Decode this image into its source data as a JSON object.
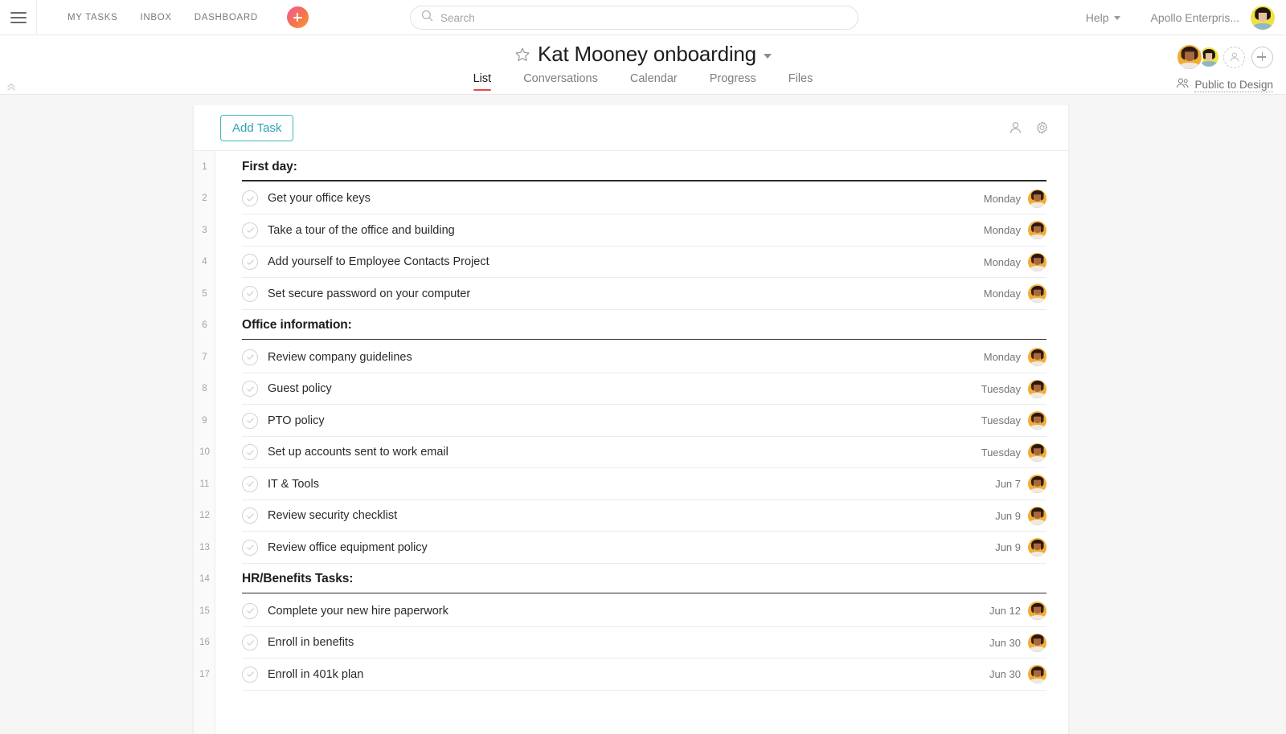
{
  "topbar": {
    "menu_icon": "hamburger-icon",
    "nav": [
      {
        "label": "MY TASKS"
      },
      {
        "label": "INBOX"
      },
      {
        "label": "DASHBOARD"
      }
    ],
    "quick_add_icon": "plus-icon",
    "search": {
      "placeholder": "Search",
      "value": "",
      "icon": "search-icon"
    },
    "help_label": "Help",
    "org_name": "Apollo Enterpris...",
    "user_avatar": "user-avatar"
  },
  "project": {
    "title": "Kat Mooney onboarding",
    "star_icon": "star-icon",
    "title_caret_icon": "chevron-down-icon",
    "tabs": [
      {
        "label": "List",
        "active": true
      },
      {
        "label": "Conversations",
        "active": false
      },
      {
        "label": "Calendar",
        "active": false
      },
      {
        "label": "Progress",
        "active": false
      },
      {
        "label": "Files",
        "active": false
      }
    ],
    "privacy_label": "Public to Design",
    "privacy_icon": "people-icon",
    "add_member_icon": "plus-circle-icon",
    "invite_placeholder_icon": "dashed-person-icon",
    "collapse_icon": "double-chevron-up-icon"
  },
  "toolbar": {
    "add_task_label": "Add Task",
    "assignee_icon": "person-icon",
    "settings_icon": "gear-icon"
  },
  "list": {
    "rows": [
      {
        "num": "1",
        "type": "section",
        "name": "First day:"
      },
      {
        "num": "2",
        "type": "task",
        "name": "Get your office keys",
        "due": "Monday",
        "assignee": "user-avatar"
      },
      {
        "num": "3",
        "type": "task",
        "name": "Take a tour of the office and building",
        "due": "Monday",
        "assignee": "user-avatar"
      },
      {
        "num": "4",
        "type": "task",
        "name": "Add yourself to Employee Contacts Project",
        "due": "Monday",
        "assignee": "user-avatar"
      },
      {
        "num": "5",
        "type": "task",
        "name": "Set secure password on your computer",
        "due": "Monday",
        "assignee": "user-avatar"
      },
      {
        "num": "6",
        "type": "section",
        "name": "Office information:"
      },
      {
        "num": "7",
        "type": "task",
        "name": "Review company guidelines",
        "due": "Monday",
        "assignee": "user-avatar"
      },
      {
        "num": "8",
        "type": "task",
        "name": "Guest policy",
        "due": "Tuesday",
        "assignee": "user-avatar"
      },
      {
        "num": "9",
        "type": "task",
        "name": "PTO policy",
        "due": "Tuesday",
        "assignee": "user-avatar"
      },
      {
        "num": "10",
        "type": "task",
        "name": "Set up accounts sent to work email",
        "due": "Tuesday",
        "assignee": "user-avatar"
      },
      {
        "num": "11",
        "type": "task",
        "name": "IT & Tools",
        "due": "Jun 7",
        "assignee": "user-avatar"
      },
      {
        "num": "12",
        "type": "task",
        "name": "Review security checklist",
        "due": "Jun 9",
        "assignee": "user-avatar"
      },
      {
        "num": "13",
        "type": "task",
        "name": "Review office equipment policy",
        "due": "Jun 9",
        "assignee": "user-avatar"
      },
      {
        "num": "14",
        "type": "section",
        "name": "HR/Benefits Tasks:"
      },
      {
        "num": "15",
        "type": "task",
        "name": "Complete your new hire paperwork",
        "due": "Jun 12",
        "assignee": "user-avatar"
      },
      {
        "num": "16",
        "type": "task",
        "name": "Enroll in benefits",
        "due": "Jun 30",
        "assignee": "user-avatar"
      },
      {
        "num": "17",
        "type": "task",
        "name": "Enroll in 401k plan",
        "due": "Jun 30",
        "assignee": "user-avatar"
      }
    ]
  },
  "colors": {
    "accent_tab_underline": "#e8474c",
    "add_task_border": "#3fb8c4",
    "add_task_text": "#2fa3b3",
    "quick_add_gradient_from": "#f2599b",
    "quick_add_gradient_to": "#f79a30",
    "page_background": "#f6f6f6",
    "card_background": "#ffffff"
  }
}
